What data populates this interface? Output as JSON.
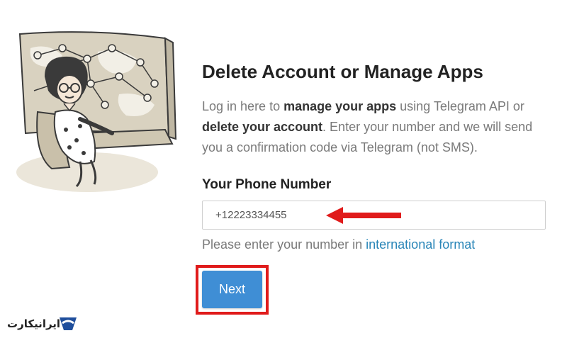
{
  "header": {
    "title": "Delete Account or Manage Apps"
  },
  "description": {
    "part1": "Log in here to ",
    "bold1": "manage your apps",
    "part2": " using Telegram API or ",
    "bold2": "delete your account",
    "part3": ". Enter your number and we will send you a confirmation code via Telegram (not SMS)."
  },
  "form": {
    "phone_label": "Your Phone Number",
    "phone_value": "+12223334455",
    "hint_prefix": "Please enter your number in ",
    "hint_link": "international format",
    "next_label": "Next"
  },
  "watermark": {
    "text": "ایرانیکارت"
  },
  "colors": {
    "accent": "#3f8ed5",
    "link": "#2a86b8",
    "highlight": "#e01b1b"
  }
}
